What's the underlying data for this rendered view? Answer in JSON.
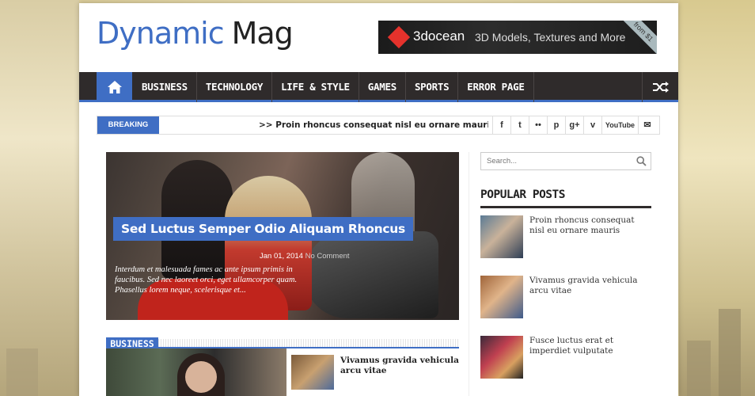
{
  "logo": {
    "part1": "Dynamic",
    "part2": "Mag"
  },
  "ad": {
    "brand": "3docean",
    "tagline": "3D Models, Textures and More",
    "ribbon": "from $1"
  },
  "nav": {
    "items": [
      "BUSINESS",
      "TECHNOLOGY",
      "LIFE & STYLE",
      "GAMES",
      "SPORTS",
      "ERROR PAGE"
    ]
  },
  "ticker": {
    "label": "BREAKING NEWS",
    "text": ">> Proin rhoncus consequat nisl eu ornare mauris  >> Vivamus gravida vehicula arcu vitae"
  },
  "socials": [
    "f",
    "t",
    "••",
    "p",
    "g+",
    "v",
    "YouTube",
    "✉"
  ],
  "hero": {
    "title": "Sed Luctus Semper Odio Aliquam Rhoncus",
    "date": "Jan 01, 2014",
    "comments": "No Comment",
    "excerpt": "Interdum et malesuada fames ac ante ipsum primis in faucibus. Sed nec laoreet orci, eget ullamcorper quam. Phasellus lorem neque, scelerisque et..."
  },
  "business": {
    "label": "BUSINESS",
    "post_title": "Vivamus gravida vehicula arcu vitae"
  },
  "search": {
    "placeholder": "Search..."
  },
  "popular": {
    "title": "POPULAR POSTS",
    "items": [
      "Proin rhoncus consequat nisl eu ornare mauris",
      "Vivamus gravida vehicula arcu vitae",
      "Fusce luctus erat et imperdiet vulputate"
    ]
  },
  "colors": {
    "accent": "#3f6ec4",
    "nav_bg": "#2f2b2b"
  }
}
